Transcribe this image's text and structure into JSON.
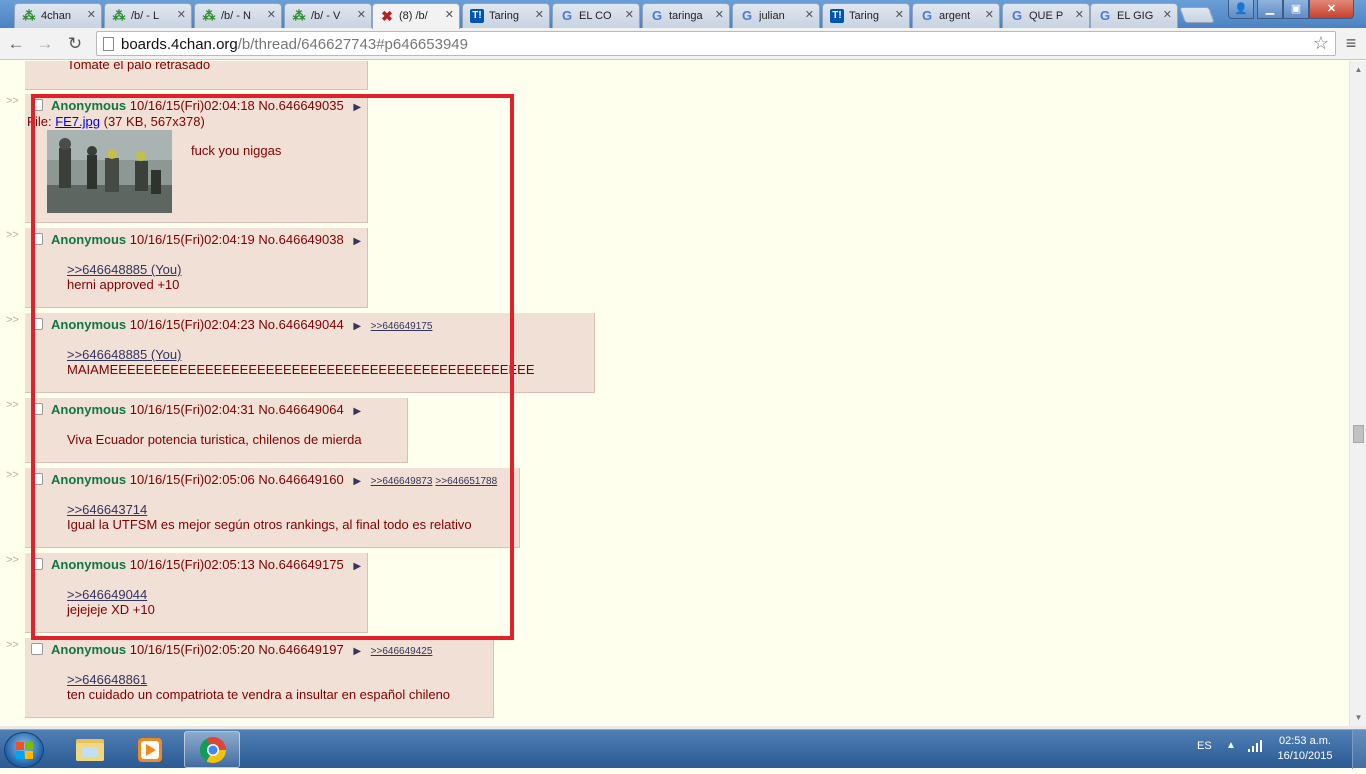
{
  "tabs": [
    {
      "title": "4chan",
      "icon": "clover"
    },
    {
      "title": "/b/ - L",
      "icon": "clover"
    },
    {
      "title": "/b/ - N",
      "icon": "clover"
    },
    {
      "title": "/b/ - V",
      "icon": "clover"
    },
    {
      "title": "(8) /b/",
      "icon": "red-x",
      "active": true
    },
    {
      "title": "Taring",
      "icon": "taringa"
    },
    {
      "title": "EL CO",
      "icon": "google"
    },
    {
      "title": "taringa",
      "icon": "google"
    },
    {
      "title": "julian",
      "icon": "google"
    },
    {
      "title": "Taring",
      "icon": "taringa"
    },
    {
      "title": "argent",
      "icon": "google"
    },
    {
      "title": "QUE P",
      "icon": "google"
    },
    {
      "title": "EL GIG",
      "icon": "google"
    }
  ],
  "address": {
    "host": "boards.4chan.org",
    "path": "/b/thread/646627743#p646653949"
  },
  "top_fragment": "Tomate el palo retrasado",
  "side_arrows": ">>",
  "posts": [
    {
      "name": "Anonymous",
      "datetime": "10/16/15(Fri)02:04:18",
      "no": "No.646649035",
      "file_label": "File:",
      "file_link": "FE7.jpg",
      "file_meta": "(37 KB, 567x378)",
      "lines": [],
      "text": "fuck you niggas",
      "backlinks": []
    },
    {
      "name": "Anonymous",
      "datetime": "10/16/15(Fri)02:04:19",
      "no": "No.646649038",
      "quote": ">>646648885 (You)",
      "text": "herni approved +10",
      "backlinks": []
    },
    {
      "name": "Anonymous",
      "datetime": "10/16/15(Fri)02:04:23",
      "no": "No.646649044",
      "quote": ">>646648885 (You)",
      "text": "MAIAMEEEEEEEEEEEEEEEEEEEEEEEEEEEEEEEEEEEEEEEEEEEEEEEEE",
      "backlinks": [
        ">>646649175"
      ]
    },
    {
      "name": "Anonymous",
      "datetime": "10/16/15(Fri)02:04:31",
      "no": "No.646649064",
      "quote": "",
      "text": "Viva Ecuador potencia turistica, chilenos de mierda",
      "backlinks": []
    },
    {
      "name": "Anonymous",
      "datetime": "10/16/15(Fri)02:05:06",
      "no": "No.646649160",
      "quote": ">>646643714",
      "text": "Igual la UTFSM es mejor según otros rankings, al final todo es relativo",
      "backlinks": [
        ">>646649873",
        ">>646651788"
      ]
    },
    {
      "name": "Anonymous",
      "datetime": "10/16/15(Fri)02:05:13",
      "no": "No.646649175",
      "quote": ">>646649044",
      "text": "jejejeje XD +10",
      "backlinks": []
    },
    {
      "name": "Anonymous",
      "datetime": "10/16/15(Fri)02:05:20",
      "no": "No.646649197",
      "quote": ">>646648861",
      "text": "ten cuidado un compatriota te vendra a insultar en español chileno",
      "backlinks": [
        ">>646649425"
      ]
    }
  ],
  "taskbar": {
    "lang": "ES",
    "time": "02:53 a.m.",
    "date": "16/10/2015"
  },
  "colors": {
    "highlight_box": "#e0202a",
    "post_bg": "#F0E0D6",
    "page_bg": "#FFFFEE",
    "name": "#117743"
  }
}
